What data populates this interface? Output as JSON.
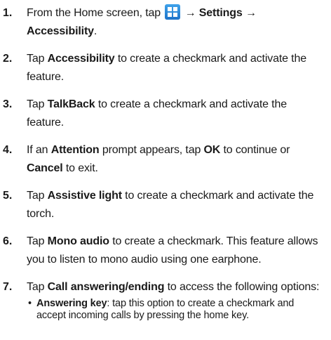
{
  "steps": [
    {
      "number": "1.",
      "line1_a": "From the Home screen, tap",
      "arrow": "→",
      "settings": "Settings",
      "accessibility": "Accessibility",
      "end": "."
    },
    {
      "number": "2.",
      "pre": "Tap ",
      "term": "Accessibility",
      "post": " to create a checkmark and activate the feature."
    },
    {
      "number": "3.",
      "pre": "Tap ",
      "term": "TalkBack",
      "post": " to create a checkmark and activate the feature."
    },
    {
      "number": "4.",
      "pre": "If an ",
      "term": "Attention",
      "mid1": " prompt appears, tap ",
      "ok": "OK",
      "mid2": " to continue or ",
      "cancel": "Cancel",
      "post": " to exit."
    },
    {
      "number": "5.",
      "pre": "Tap ",
      "term": "Assistive light",
      "post": " to create a checkmark and activate the torch."
    },
    {
      "number": "6.",
      "pre": "Tap ",
      "term": "Mono audio",
      "post": " to create a checkmark. This feature allows you to listen to mono audio using one earphone."
    },
    {
      "number": "7.",
      "pre": "Tap ",
      "term": "Call answering/ending",
      "post": " to access the following options:",
      "bullet": "•",
      "sub_term": "Answering key",
      "sub_post": ": tap this option to create a checkmark and accept incoming calls by pressing the home key."
    }
  ],
  "icons": {
    "apps": "apps-grid-icon"
  },
  "colors": {
    "apps_icon": "#2a8ad8",
    "text": "#1a1a1a"
  }
}
